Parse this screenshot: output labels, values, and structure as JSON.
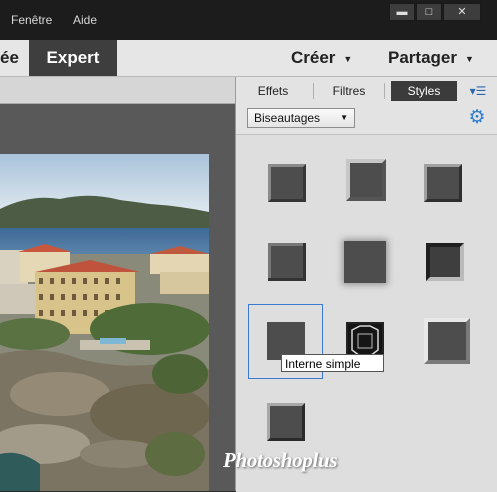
{
  "menu": {
    "items": [
      "Fenêtre",
      "Aide"
    ]
  },
  "window": {
    "minimize_glyph": "▬",
    "maximize_glyph": "□",
    "close_glyph": "✕"
  },
  "modes": {
    "partial": "ée",
    "expert": "Expert",
    "create": "Créer",
    "share": "Partager"
  },
  "panel": {
    "tabs": [
      "Effets",
      "Filtres",
      "Styles"
    ],
    "active_tab": "Styles",
    "category": "Biseautages",
    "tooltip": "Interne simple",
    "selected_swatch": "Interne simple"
  },
  "watermark": "Photoshoplus",
  "icons": {
    "gear": "gear-icon",
    "panel_menu": "panel-menu-icon",
    "dropdown_caret": "chevron-down-icon"
  },
  "colors": {
    "accent": "#2f7fd0",
    "menubar": "#1c1c1c",
    "swatch": "#4d4d4d"
  }
}
